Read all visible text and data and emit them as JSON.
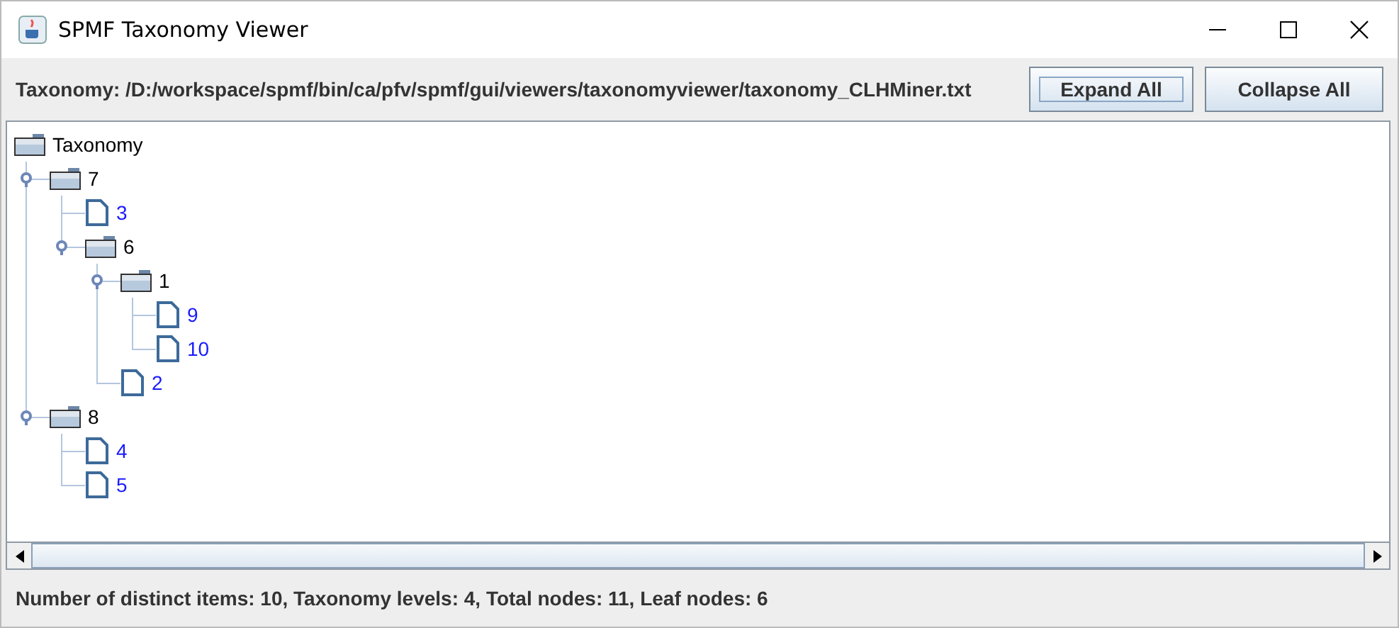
{
  "window": {
    "title": "SPMF Taxonomy Viewer"
  },
  "toolbar": {
    "path_label": "Taxonomy: /D:/workspace/spmf/bin/ca/pfv/spmf/gui/viewers/taxonomyviewer/taxonomy_CLHMiner.txt",
    "buttons": [
      {
        "label": "Expand All",
        "focused": true
      },
      {
        "label": "Collapse All",
        "focused": false
      }
    ]
  },
  "tree": {
    "label": "Taxonomy",
    "children": [
      {
        "label": "7",
        "kind": "folder",
        "expanded": true,
        "children": [
          {
            "label": "3",
            "kind": "item"
          },
          {
            "label": "6",
            "kind": "folder",
            "expanded": true,
            "children": [
              {
                "label": "1",
                "kind": "folder",
                "expanded": true,
                "children": [
                  {
                    "label": "9",
                    "kind": "item"
                  },
                  {
                    "label": "10",
                    "kind": "item"
                  }
                ]
              },
              {
                "label": "2",
                "kind": "item"
              }
            ]
          }
        ]
      },
      {
        "label": "8",
        "kind": "folder",
        "expanded": true,
        "children": [
          {
            "label": "4",
            "kind": "item"
          },
          {
            "label": "5",
            "kind": "item"
          }
        ]
      }
    ]
  },
  "status_bar": "Number of distinct items: 10, Taxonomy levels: 4, Total nodes: 11, Leaf nodes: 6"
}
